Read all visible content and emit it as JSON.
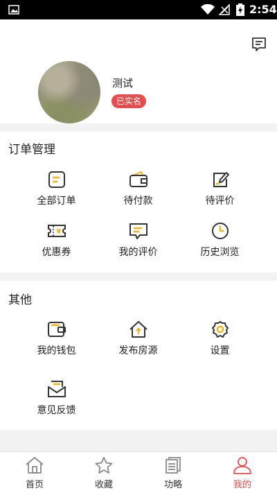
{
  "status_bar": {
    "time": "2:54"
  },
  "profile": {
    "username": "测试",
    "badge": "已实名"
  },
  "orders": {
    "title": "订单管理",
    "items": [
      {
        "label": "全部订单",
        "icon": "order-list-icon"
      },
      {
        "label": "待付款",
        "icon": "wallet-icon"
      },
      {
        "label": "待评价",
        "icon": "edit-icon"
      },
      {
        "label": "优惠券",
        "icon": "coupon-icon"
      },
      {
        "label": "我的评价",
        "icon": "comment-icon"
      },
      {
        "label": "历史浏览",
        "icon": "clock-icon"
      }
    ]
  },
  "other": {
    "title": "其他",
    "items": [
      {
        "label": "我的钱包",
        "icon": "wallet-icon"
      },
      {
        "label": "发布房源",
        "icon": "house-upload-icon"
      },
      {
        "label": "设置",
        "icon": "settings-icon"
      },
      {
        "label": "意见反馈",
        "icon": "feedback-icon"
      }
    ]
  },
  "tabs": [
    {
      "label": "首页",
      "icon": "home-icon"
    },
    {
      "label": "收藏",
      "icon": "star-icon"
    },
    {
      "label": "功略",
      "icon": "guide-icon"
    },
    {
      "label": "我的",
      "icon": "user-icon",
      "active": true
    }
  ],
  "colors": {
    "accent": "#e94c4c",
    "icon_yellow": "#f5b31a",
    "icon_dark": "#333333"
  }
}
